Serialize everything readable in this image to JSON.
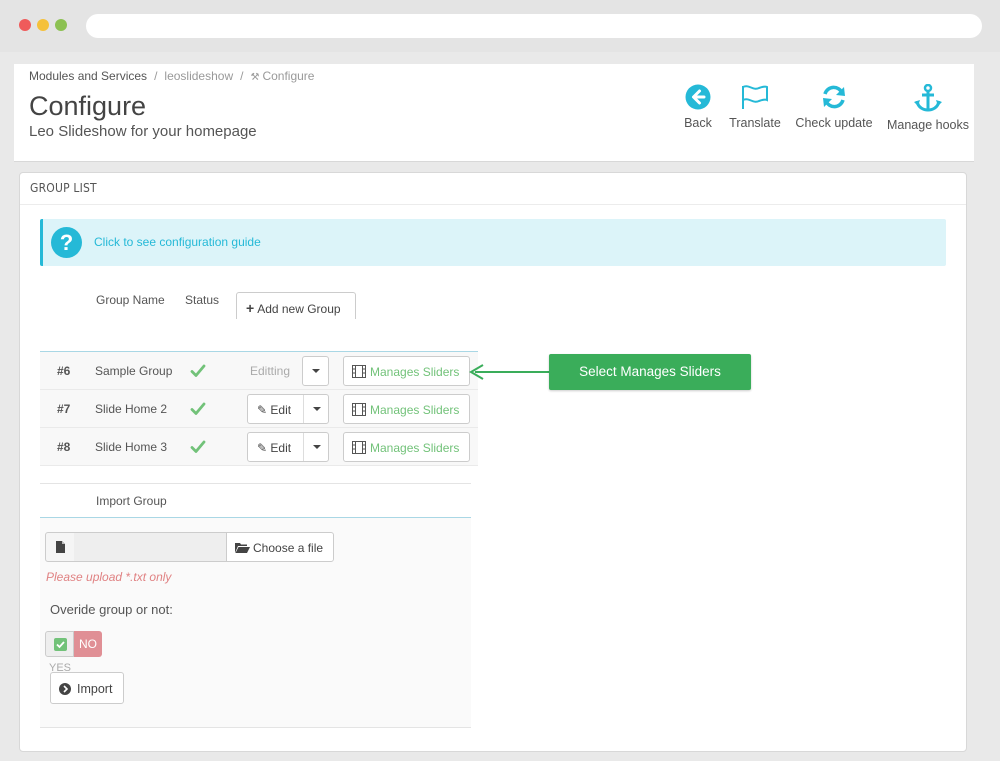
{
  "breadcrumb": {
    "item1": "Modules and Services",
    "sep1": "/",
    "item2": "leoslideshow",
    "sep2": "/",
    "item3": "Configure"
  },
  "header": {
    "title": "Configure",
    "subtitle": "Leo Slideshow for your homepage"
  },
  "toolbar": {
    "back_label": "Back",
    "translate_label": "Translate",
    "check_update_label": "Check update",
    "manage_hooks_label": "Manage hooks",
    "icon_color": "#25b9d7"
  },
  "panel": {
    "heading": "GROUP LIST"
  },
  "alert": {
    "link_text": "Click to see configuration guide"
  },
  "table": {
    "col_name": "Group Name",
    "col_status": "Status",
    "add_group_label": "Add new Group",
    "rows": [
      {
        "num": "#6",
        "name": "Sample Group",
        "action": "Editting",
        "manage": "Manages Sliders"
      },
      {
        "num": "#7",
        "name": "Slide Home 2",
        "action": "Edit",
        "manage": "Manages Sliders"
      },
      {
        "num": "#8",
        "name": "Slide Home 3",
        "action": "Edit",
        "manage": "Manages Sliders"
      }
    ]
  },
  "callout": {
    "text": "Select Manages Sliders",
    "color": "#3aad5a"
  },
  "import": {
    "heading": "Import Group",
    "file_value": "",
    "choose_label": "Choose a file",
    "help_text": "Please upload *.txt only",
    "override_label": "Overide group or not:",
    "yes_label": "YES",
    "no_label": "NO",
    "import_label": "Import"
  }
}
